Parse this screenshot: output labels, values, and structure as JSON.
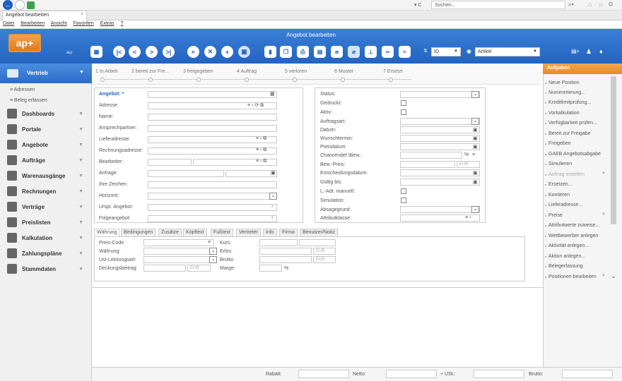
{
  "browser": {
    "address_placeholder": "Suchen...",
    "refresh": "▾ C",
    "tab_title": "Angebot bearbeiten"
  },
  "menubar": [
    "Datei",
    "Bearbeiten",
    "Ansicht",
    "Favoriten",
    "Extras",
    "?"
  ],
  "app": {
    "title": "Angebot bearbeiten",
    "logo": "ap+",
    "id_value": "ID",
    "article_value": "Artikel"
  },
  "sidebar": {
    "active": "Vertrieb",
    "sub_items": [
      "Adressen",
      "Beleg erfassen"
    ],
    "items": [
      "Dashboards",
      "Portale",
      "Angebote",
      "Aufträge",
      "Warenausgänge",
      "Rechnungen",
      "Verträge",
      "Preislisten",
      "Kalkulation",
      "Zahlungspläne",
      "Stammdaten"
    ]
  },
  "steps": [
    "1 In Arbeit",
    "2 bereit zur Fre...",
    "3 freigegeben",
    "4 Auftrag",
    "5 verloren",
    "6 Muster",
    "7 Ersetzt"
  ],
  "left_form": {
    "labels": [
      "Angebot: *",
      "Adresse:",
      "Name:",
      "Ansprechpartner:",
      "Lieferadresse:",
      "Rechnungsadresse:",
      "Bearbeiter:",
      "Anfrage:",
      "Ihre Zeichen:",
      "Horizont:",
      "Urspr. Angebot:",
      "Folgeangebot:"
    ]
  },
  "right_form": {
    "labels": [
      "Status:",
      "Gedruckt:",
      "Aktiv:",
      "Auftragsart:",
      "Datum:",
      "Wunschtermin:",
      "Preisdatum:",
      "Chancendef.\\Bew.:",
      "Bew.-Preis:",
      "Entscheidungsdatum:",
      "Gültig bis:",
      "L.-Adr. manuell:",
      "Simulation:",
      "Absagegrund:",
      "Attributklasse:"
    ],
    "percent": "%",
    "currency": "EUR"
  },
  "tabs": [
    "Währung",
    "Bedingungen",
    "Zusätze",
    "Kopftext",
    "Fußtext",
    "Vertreter",
    "Info",
    "Firma",
    "Benutzer/Notiz"
  ],
  "currency_tab": {
    "labels_left": [
      "Preis-Code:",
      "Währung:",
      "Ust-Leistungsart:",
      "Deckungsbeitrag:"
    ],
    "labels_right": [
      "Kurs:",
      "Erlös:",
      "Brutto:",
      "Marge:"
    ],
    "eur": "EUR",
    "percent": "%"
  },
  "tasks": {
    "header": "Aufgaben",
    "items": [
      "Neue Position",
      "Nummerierung...",
      "Kreditlimitprüfung...",
      "Vorkalkulation",
      "Verfügbarkeit prüfen...",
      "Bereit zur Freigabe",
      "Freigeben",
      "GAEB Angebotsabgabe",
      "Simulieren",
      "Auftrag erstellen",
      "Ersetzen...",
      "Kontieren",
      "Lieferadresse...",
      "Preise",
      "Attributwerte zuweise...",
      "Wettbewerber anlegen",
      "Aktivität anlegen...",
      "Aktion anlegen...",
      "Belegerfassung",
      "Positionen bearbeiten"
    ]
  },
  "footer": {
    "labels": [
      "Rabatt:",
      "Netto:",
      "+ USt.:",
      "Brutto:"
    ]
  }
}
